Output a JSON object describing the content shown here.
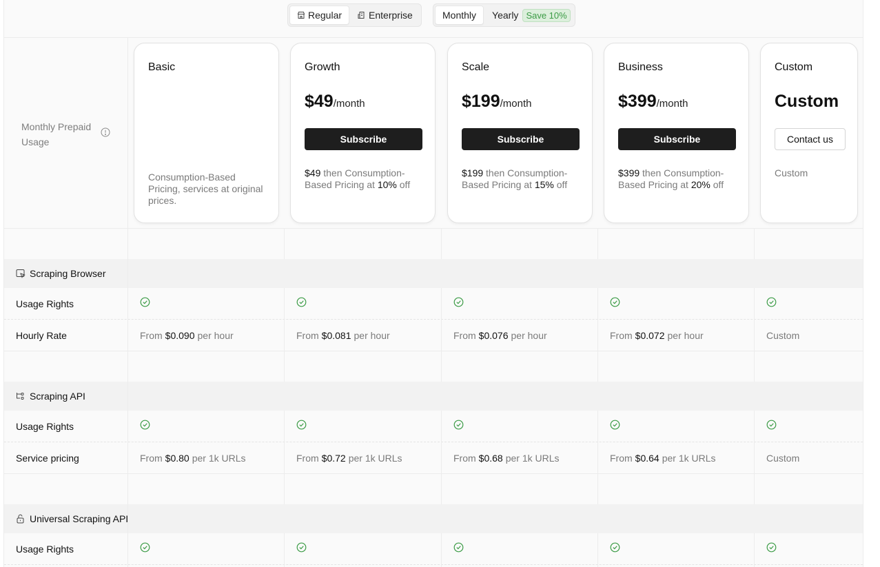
{
  "toggles": {
    "type_options": [
      {
        "label": "Regular",
        "active": true,
        "icon": "store-icon"
      },
      {
        "label": "Enterprise",
        "active": false,
        "icon": "building-icon"
      }
    ],
    "billing_options": [
      {
        "label": "Monthly",
        "active": true
      },
      {
        "label": "Yearly",
        "active": false
      }
    ],
    "save_badge": "Save 10%"
  },
  "prepaid_label": "Monthly Prepaid Usage",
  "plans": [
    {
      "name": "Basic",
      "price": "",
      "per": "",
      "button": "",
      "desc_parts": [
        "Consumption-Based Pricing, services at original prices."
      ]
    },
    {
      "name": "Growth",
      "price": "$49",
      "per": "/month",
      "button": "Subscribe",
      "desc_a": "$49",
      "desc_b": " then Consumption-Based Pricing at ",
      "desc_c": "10%",
      "desc_d": " off"
    },
    {
      "name": "Scale",
      "price": "$199",
      "per": "/month",
      "button": "Subscribe",
      "desc_a": "$199",
      "desc_b": " then Consumption-Based Pricing at ",
      "desc_c": "15%",
      "desc_d": " off"
    },
    {
      "name": "Business",
      "price": "$399",
      "per": "/month",
      "button": "Subscribe",
      "desc_a": "$399",
      "desc_b": " then Consumption-Based Pricing at ",
      "desc_c": "20%",
      "desc_d": " off"
    },
    {
      "name": "Custom",
      "price": "Custom",
      "per": "",
      "button": "Contact us",
      "desc": "Custom"
    }
  ],
  "sections": [
    {
      "title": "Scraping Browser",
      "icon": "browser-cursor-icon",
      "rows": [
        {
          "label": "Usage Rights",
          "type": "check"
        },
        {
          "label": "Hourly Rate",
          "type": "price",
          "cells": [
            {
              "pre": "From",
              "val": "$0.090",
              "post": "per hour"
            },
            {
              "pre": "From",
              "val": "$0.081",
              "post": "per hour"
            },
            {
              "pre": "From",
              "val": "$0.076",
              "post": "per hour"
            },
            {
              "pre": "From",
              "val": "$0.072",
              "post": "per hour"
            },
            {
              "pre": "Custom",
              "val": "",
              "post": ""
            }
          ]
        }
      ]
    },
    {
      "title": "Scraping API",
      "icon": "api-flow-icon",
      "rows": [
        {
          "label": "Usage Rights",
          "type": "check"
        },
        {
          "label": "Service pricing",
          "type": "price",
          "cells": [
            {
              "pre": "From",
              "val": "$0.80",
              "post": "per 1k URLs"
            },
            {
              "pre": "From",
              "val": "$0.72",
              "post": "per 1k URLs"
            },
            {
              "pre": "From",
              "val": "$0.68",
              "post": "per 1k URLs"
            },
            {
              "pre": "From",
              "val": "$0.64",
              "post": "per 1k URLs"
            },
            {
              "pre": "Custom",
              "val": "",
              "post": ""
            }
          ]
        }
      ]
    },
    {
      "title": "Universal Scraping API",
      "icon": "unlock-icon",
      "rows": [
        {
          "label": "Usage Rights",
          "type": "check"
        }
      ]
    }
  ],
  "colors": {
    "check": "#3b9b45",
    "button": "#1e1e1e",
    "muted_text": "#7a7a7a"
  }
}
